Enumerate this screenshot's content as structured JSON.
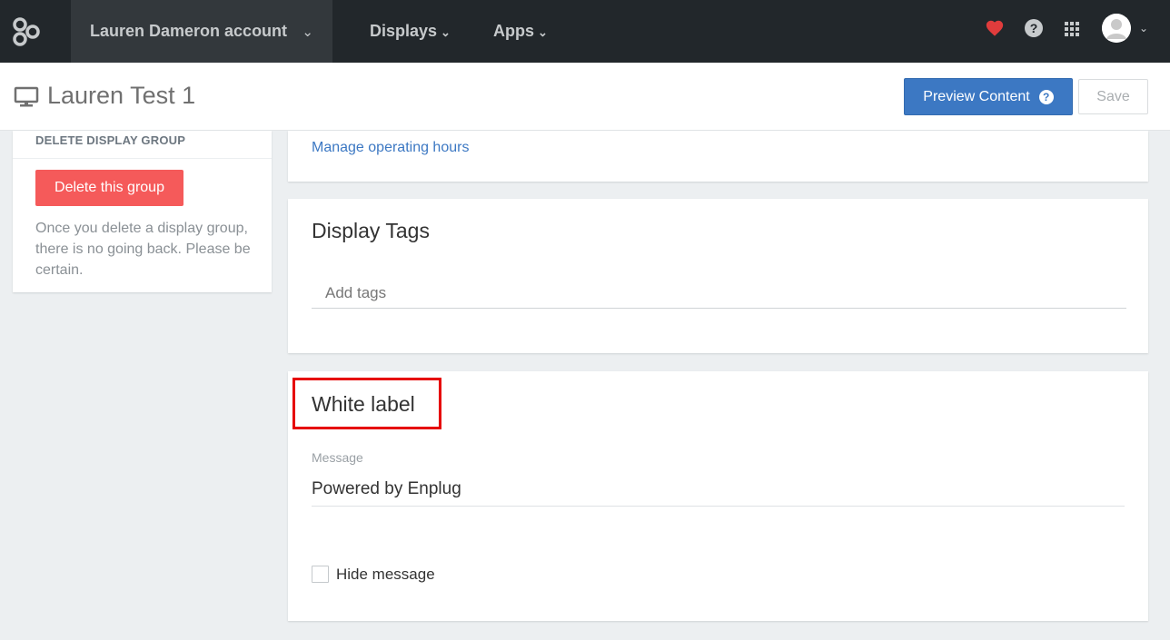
{
  "topnav": {
    "account_label": "Lauren Dameron account",
    "nav_displays": "Displays",
    "nav_apps": "Apps",
    "chevron": "⌄",
    "help_glyph": "?",
    "heart_color": "#e03c3c",
    "bg_color": "#22272b"
  },
  "header": {
    "page_title": "Lauren Test 1",
    "preview_label": "Preview Content",
    "preview_help_glyph": "?",
    "save_label": "Save"
  },
  "left_panel": {
    "heading": "DELETE DISPLAY GROUP",
    "delete_button": "Delete this group",
    "description": "Once you delete a display group, there is no going back. Please be certain."
  },
  "operating_hours": {
    "link": "Manage operating hours"
  },
  "display_tags": {
    "title": "Display Tags",
    "placeholder": "Add tags"
  },
  "white_label": {
    "title": "White label",
    "message_label": "Message",
    "message_value": "Powered by Enplug",
    "hide_label": "Hide message",
    "hide_checked": false
  },
  "colors": {
    "accent": "#3c78c3",
    "danger": "#f55a5a",
    "highlight": "#e60000"
  }
}
